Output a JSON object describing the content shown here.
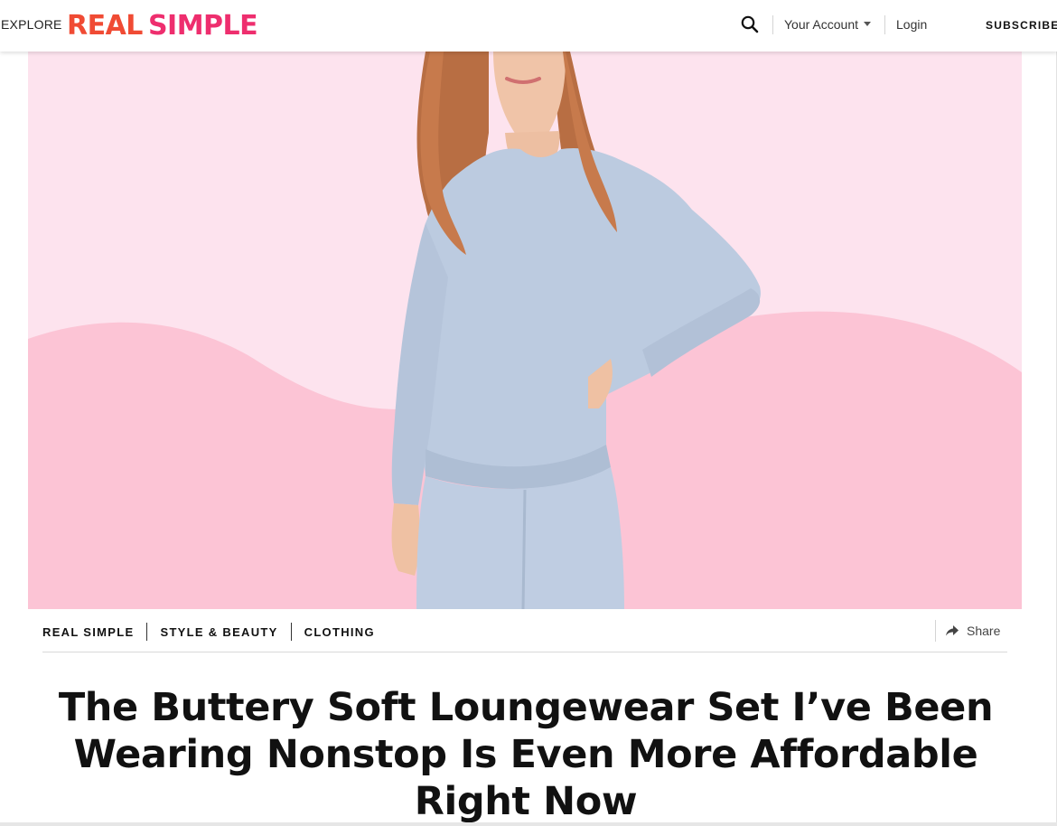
{
  "header": {
    "explore_label": "EXPLORE",
    "logo_word1": "REAL",
    "logo_word2": "SIMPLE",
    "account_label": "Your Account",
    "login_label": "Login",
    "subscribe_label": "SUBSCRIBE"
  },
  "hero": {
    "icon": "hero-image",
    "bg_color": "#fde3ee",
    "wave_color": "#fcc4d5",
    "garment_color": "#bccbe0"
  },
  "breadcrumb": {
    "items": [
      "REAL SIMPLE",
      "STYLE & BEAUTY",
      "CLOTHING"
    ]
  },
  "share": {
    "label": "Share"
  },
  "article": {
    "title": "The Buttery Soft Loungewear Set I’ve Been Wearing Nonstop Is Even More Affordable Right Now"
  },
  "colors": {
    "logo_orange": "#f04b34",
    "logo_pink": "#ee2e6e"
  }
}
